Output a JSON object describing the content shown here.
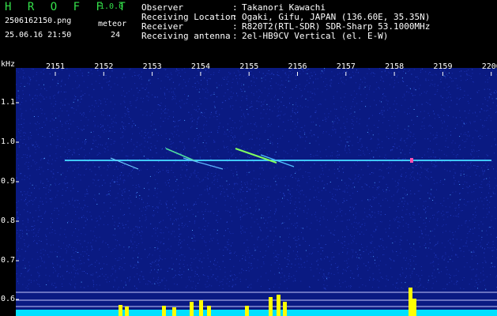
{
  "app": {
    "name": "H R O F F T",
    "version": "1.0.0",
    "filename": "2506162150.png",
    "datetime": "25.06.16 21:50",
    "event_label": "meteor",
    "event_count": "24"
  },
  "info": [
    {
      "key": "Observer",
      "sep": ":",
      "value": "Takanori Kawachi"
    },
    {
      "key": "Receiving Location",
      "sep": ":",
      "value": "Ogaki, Gifu, JAPAN (136.60E, 35.35N)"
    },
    {
      "key": "Receiver",
      "sep": ":",
      "value": "R820T2(RTL-SDR) SDR-Sharp 53.1000MHz"
    },
    {
      "key": "Receiving antenna",
      "sep": ":",
      "value": "2el-HB9CV Vertical (el. E-W)"
    }
  ],
  "axes": {
    "y_unit": "kHz",
    "y_ticks": [
      "1.1",
      "1.0",
      "0.9",
      "0.8",
      "0.7",
      "0.6"
    ],
    "x_ticks": [
      "2151",
      "2152",
      "2153",
      "2154",
      "2155",
      "2156",
      "2157",
      "2158",
      "2159",
      "2200"
    ]
  },
  "colors": {
    "background": "#000000",
    "plot_background": "#0a1a82",
    "noise_dot": "#2848d0",
    "carrier": "#40c8ff",
    "header_text": "#ffffff",
    "logo_green": "#34e04a",
    "spike": "#ffff00",
    "baseline": "#00e0ff"
  }
}
